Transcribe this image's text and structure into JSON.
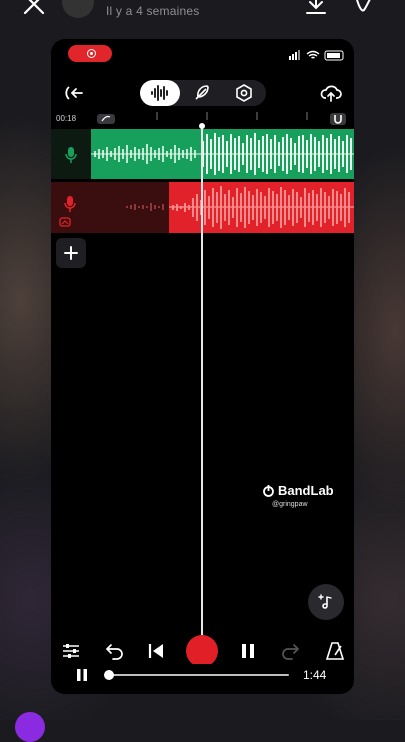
{
  "story": {
    "posted_time": "Il y a 4 semaines",
    "icons": [
      "close-icon",
      "download-icon",
      "edit-icon"
    ]
  },
  "app": {
    "timecode": "00:18",
    "brand": "BandLab",
    "handle": "@gringpaw",
    "duration": "1:44",
    "progress": 0.01,
    "track_colors": {
      "vocals_green": "#16a05c",
      "recording_red": "#e2222a"
    },
    "toolbar_icons": [
      "back-icon",
      "waveform-icon",
      "feather-icon",
      "settings-hex-icon",
      "cloud-upload-icon"
    ],
    "bottom_controls": [
      "mixer-icon",
      "undo-icon",
      "skip-back-icon",
      "record-button",
      "pause-icon",
      "redo-icon",
      "metronome-icon"
    ]
  }
}
